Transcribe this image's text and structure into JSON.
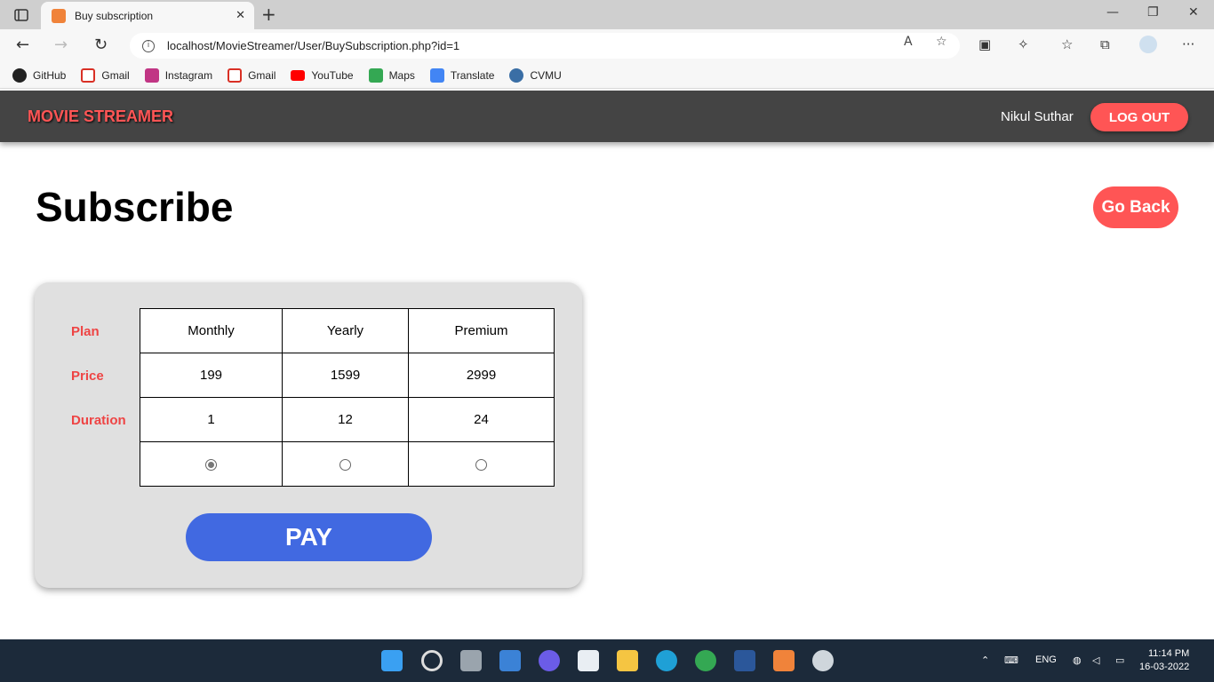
{
  "browser": {
    "tab_title": "Buy subscription",
    "url": "localhost/MovieStreamer/User/BuySubscription.php?id=1",
    "bookmarks": [
      {
        "label": "GitHub",
        "icon": "github-icon",
        "color": "#222222"
      },
      {
        "label": "Gmail",
        "icon": "gmail-icon",
        "color": "#d93025"
      },
      {
        "label": "Instagram",
        "icon": "instagram-icon",
        "color": "#c13584"
      },
      {
        "label": "Gmail",
        "icon": "gmail-icon",
        "color": "#d93025"
      },
      {
        "label": "YouTube",
        "icon": "youtube-icon",
        "color": "#ff0000"
      },
      {
        "label": "Maps",
        "icon": "maps-icon",
        "color": "#34a853"
      },
      {
        "label": "Translate",
        "icon": "translate-icon",
        "color": "#4285f4"
      },
      {
        "label": "CVMU",
        "icon": "cvmu-icon",
        "color": "#3a6ea5"
      }
    ]
  },
  "navbar": {
    "brand": "MOVIE STREAMER",
    "username": "Nikul Suthar",
    "logout_label": "LOG OUT"
  },
  "page": {
    "heading": "Subscribe",
    "go_back_label": "Go Back",
    "pay_label": "PAY"
  },
  "subscription": {
    "row_labels": {
      "plan": "Plan",
      "price": "Price",
      "duration": "Duration"
    },
    "plans": [
      {
        "name": "Monthly",
        "price": "199",
        "duration": "1",
        "selected": true
      },
      {
        "name": "Yearly",
        "price": "1599",
        "duration": "12",
        "selected": false
      },
      {
        "name": "Premium",
        "price": "2999",
        "duration": "24",
        "selected": false
      }
    ]
  },
  "taskbar": {
    "language": "ENG",
    "time": "11:14 PM",
    "date": "16-03-2022"
  },
  "colors": {
    "accent_red": "#ff5555",
    "pay_blue": "#4169e1",
    "navbar_bg": "#444444"
  }
}
